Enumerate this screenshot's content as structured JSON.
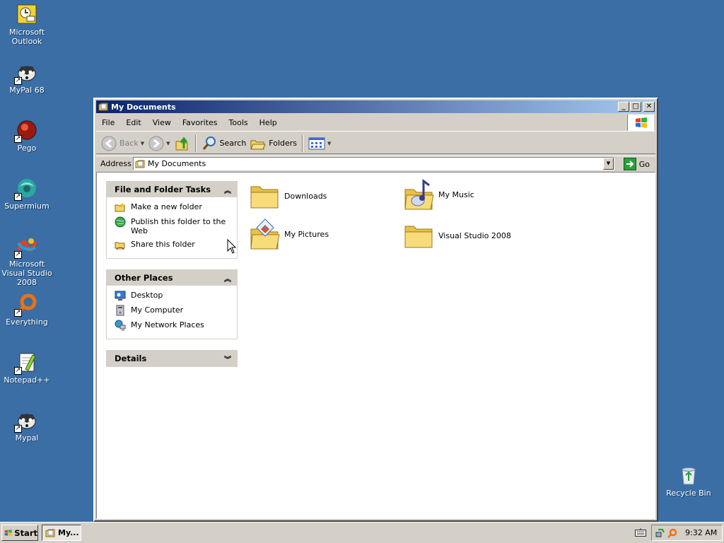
{
  "desktop": {
    "icons": [
      {
        "label": "Microsoft Outlook",
        "icon": "outlook-icon"
      },
      {
        "label": "MyPal 68",
        "icon": "mypal-icon"
      },
      {
        "label": "Pego",
        "icon": "pego-icon"
      },
      {
        "label": "Supermium",
        "icon": "supermium-icon"
      },
      {
        "label": "Microsoft Visual Studio 2008",
        "icon": "visual-studio-icon"
      },
      {
        "label": "Everything",
        "icon": "everything-icon"
      },
      {
        "label": "Notepad++",
        "icon": "notepadpp-icon"
      },
      {
        "label": "Mypal",
        "icon": "mypal-icon"
      },
      {
        "label": "Recycle Bin",
        "icon": "recycle-bin-icon"
      }
    ]
  },
  "window": {
    "title": "My Documents",
    "menu": [
      "File",
      "Edit",
      "View",
      "Favorites",
      "Tools",
      "Help"
    ],
    "toolbar": {
      "back": "Back",
      "search": "Search",
      "folders": "Folders"
    },
    "address": {
      "label": "Address",
      "value": "My Documents",
      "go": "Go"
    },
    "tasks": {
      "file_folder": {
        "title": "File and Folder Tasks",
        "items": [
          "Make a new folder",
          "Publish this folder to the Web",
          "Share this folder"
        ]
      },
      "other_places": {
        "title": "Other Places",
        "items": [
          "Desktop",
          "My Computer",
          "My Network Places"
        ]
      },
      "details": {
        "title": "Details"
      }
    },
    "files": [
      "Downloads",
      "My Music",
      "My Pictures",
      "Visual Studio 2008"
    ]
  },
  "taskbar": {
    "start": "Start",
    "task": "My...",
    "clock": "9:32 AM"
  },
  "colors": {
    "desktop": "#3a6ea5",
    "titlebar_start": "#0a246a",
    "titlebar_end": "#a6caf0",
    "chrome": "#d4d0c8"
  }
}
